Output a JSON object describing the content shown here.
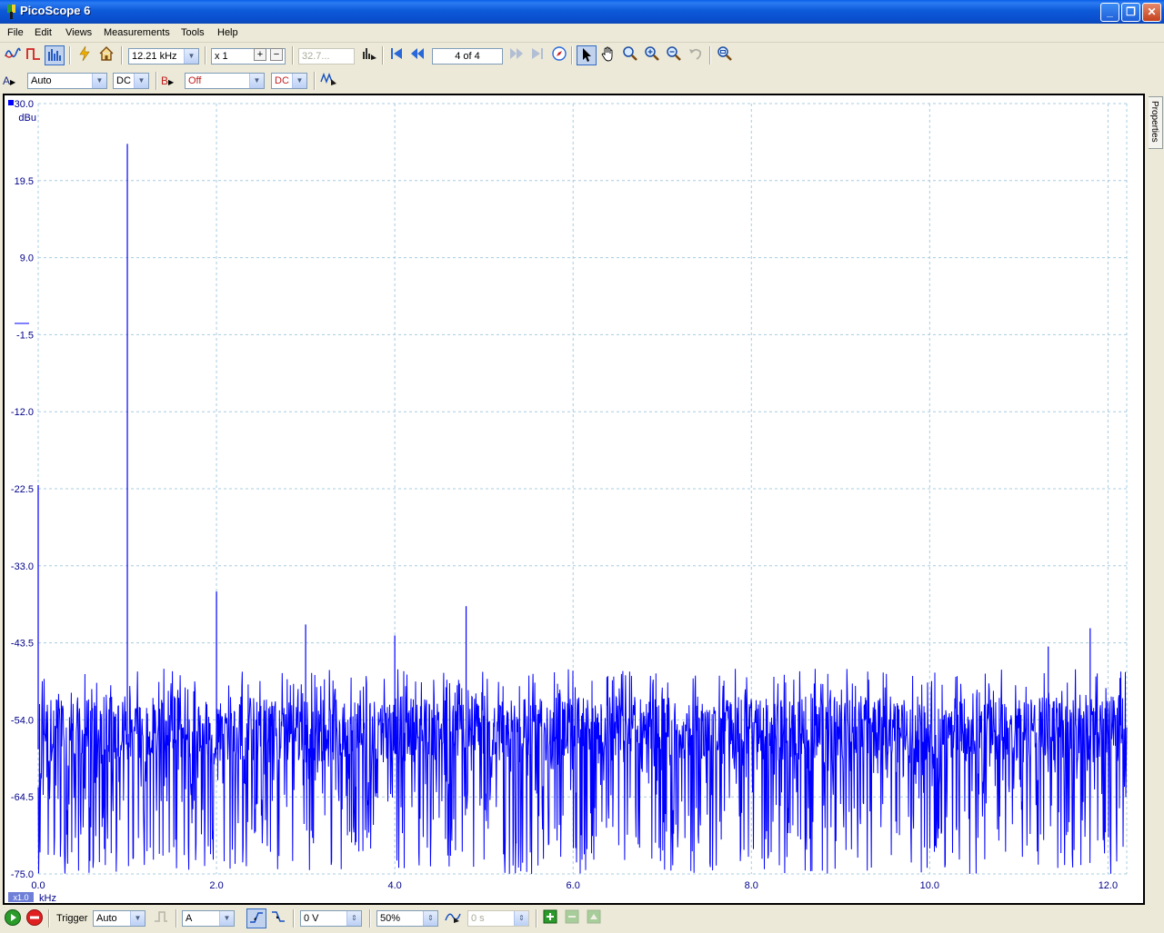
{
  "app": {
    "title": "PicoScope 6"
  },
  "menu": [
    "File",
    "Edit",
    "Views",
    "Measurements",
    "Tools",
    "Help"
  ],
  "toolbar1": {
    "timebase": "12.21 kHz",
    "zoom": "x 1",
    "samples": "32.7...",
    "buffer": "4 of 4"
  },
  "toolbar2": {
    "channel_a_label": "A",
    "channel_a_range": "Auto",
    "channel_a_coupling": "DC",
    "channel_b_label": "B",
    "channel_b_range": "Off",
    "channel_b_coupling": "DC"
  },
  "properties_tab": "Properties",
  "bottom": {
    "trigger_label": "Trigger",
    "trigger_mode": "Auto",
    "trigger_channel": "A",
    "threshold": "0 V",
    "pretrigger": "50%",
    "delay": "0 s"
  },
  "colors": {
    "trace": "#0000ff",
    "grid": "#a8cce0",
    "axis_text": "#00008b"
  },
  "chart_data": {
    "type": "line",
    "title": "",
    "ylabel": "dBu",
    "xlabel": "kHz",
    "scale_badge": "x1.0",
    "ylim": [
      -75.0,
      30.0
    ],
    "xlim": [
      0.0,
      12.21
    ],
    "y_ticks": [
      "30.0",
      "19.5",
      "9.0",
      "-1.5",
      "-12.0",
      "-22.5",
      "-33.0",
      "-43.5",
      "-54.0",
      "-64.5",
      "-75.0"
    ],
    "x_ticks": [
      "0.0",
      "2.0",
      "4.0",
      "6.0",
      "8.0",
      "10.0",
      "12.0"
    ],
    "noise_floor": {
      "mean": -58.0,
      "min": -75.0,
      "max": -47.0
    },
    "peaks": [
      {
        "x": 0.0,
        "y": -22.0
      },
      {
        "x": 1.0,
        "y": 24.5
      },
      {
        "x": 2.0,
        "y": -36.5
      },
      {
        "x": 3.0,
        "y": -41.0
      },
      {
        "x": 4.0,
        "y": -42.5
      },
      {
        "x": 4.8,
        "y": -38.5
      },
      {
        "x": 11.33,
        "y": -44.0
      },
      {
        "x": 11.8,
        "y": -41.5
      }
    ],
    "grid": true
  }
}
